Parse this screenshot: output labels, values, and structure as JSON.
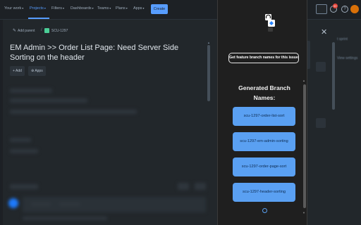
{
  "topbar": {
    "your_work": "Your work",
    "projects": "Projects",
    "filters": "Filters",
    "dashboards": "Dashboards",
    "teams": "Teams",
    "plans": "Plans",
    "apps": "Apps",
    "create": "Create",
    "notification_count": "9+",
    "help": "?"
  },
  "issue": {
    "add_parent": "Add parent",
    "issue_key": "SCU-1297",
    "title": "EM Admin >> Order List Page: Need Server Side Sorting on the header",
    "add_button": "Add",
    "apps_button": "Apps"
  },
  "right_panel": {
    "start_sprint": "t sprint",
    "view_settings": "View settings"
  },
  "extension": {
    "get_button": "Get feature branch names for this issue",
    "generated_title": "Generated Branch Names:",
    "branches": [
      "scu-1297-order-list-sort",
      "scu-1297-em-admin-sorting",
      "scu-1297-order-page-sort",
      "scu-1297-header-sorting"
    ]
  },
  "colors": {
    "jira_blue": "#579dff",
    "branch_blue": "#5aa0f2",
    "popup_bg": "#1f1f1f",
    "modal_bg": "#22272b"
  }
}
